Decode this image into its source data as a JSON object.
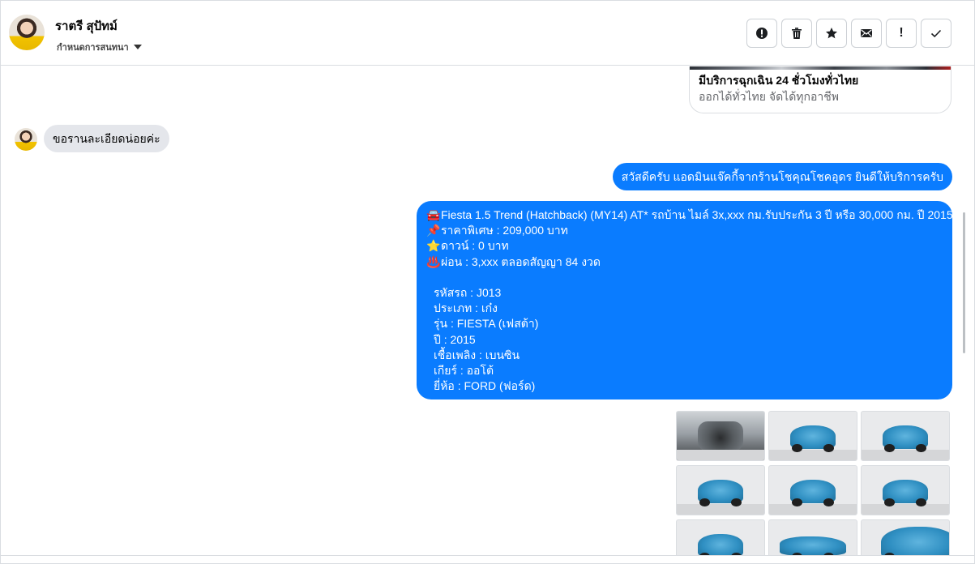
{
  "header": {
    "contact_name": "ราตรี สุปัทม์",
    "status_label": "กำหนดการสนทนา",
    "toolbar": [
      {
        "name": "report-button",
        "icon": "alert-circle-icon"
      },
      {
        "name": "delete-button",
        "icon": "trash-icon"
      },
      {
        "name": "star-button",
        "icon": "star-icon"
      },
      {
        "name": "mail-button",
        "icon": "envelope-icon"
      },
      {
        "name": "mark-important-button",
        "icon": "exclamation-icon"
      },
      {
        "name": "mark-done-button",
        "icon": "check-icon"
      }
    ]
  },
  "link_card": {
    "title": "มีบริการฉุกเฉิน 24 ชั่วโมงทั่วไทย",
    "subtitle": "ออกได้ทั่วไทย จัดได้ทุกอาชีพ"
  },
  "messages": {
    "incoming_1": "ขอรานละเอียดน่อยค่ะ",
    "outgoing_1": "สวัสดีครับ แอดมินแจ๊คกี้จากร้านโชคุณโชคอุดร ยินดีให้บริการครับ",
    "outgoing_2": {
      "lines": [
        {
          "emoji": "🚘",
          "text": "Fiesta 1.5 Trend (Hatchback) (MY14) AT* รถบ้าน ไมล์ 3x,xxx กม.รับประกัน 3 ปี หรือ 30,000 กม. ปี 2015"
        },
        {
          "emoji": "📌",
          "text": "ราคาพิเศษ : 209,000 บาท"
        },
        {
          "emoji": "⭐",
          "text": "ดาวน์ : 0 บาท"
        },
        {
          "emoji": "♨️",
          "text": "ผ่อน : 3,xxx ตลอดสัญญา 84 งวด"
        }
      ],
      "details": [
        "รหัสรถ : J013",
        "ประเภท : เก๋ง",
        "รุ่น : FIESTA (เฟสต้า)",
        "ปี : 2015",
        "เชื้อเพลิง : เบนซิน",
        "เกียร์ : ออโต้",
        "ยี่ห้อ : FORD (ฟอร์ด)"
      ]
    }
  },
  "colors": {
    "outgoing_bubble": "#0a7cff",
    "incoming_bubble": "#e4e6eb",
    "border": "#dadde1"
  }
}
